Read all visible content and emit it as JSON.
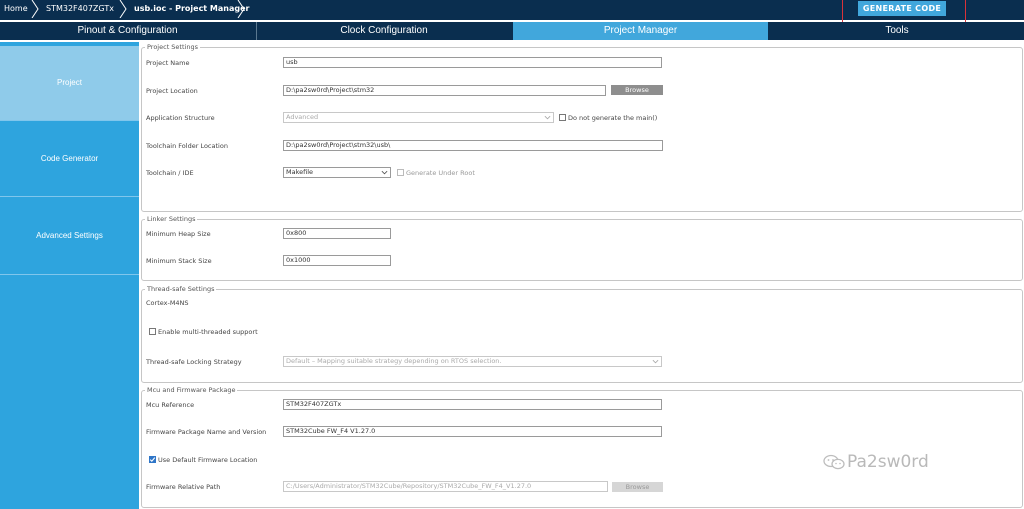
{
  "breadcrumb": {
    "home": "Home",
    "device": "STM32F407ZGTx",
    "file": "usb.ioc - Project Manager"
  },
  "toolbar": {
    "generate_code": "GENERATE CODE",
    "highlight_color": "#d9333a"
  },
  "tabs": [
    {
      "label": "Pinout & Configuration",
      "active": false
    },
    {
      "label": "Clock Configuration",
      "active": false
    },
    {
      "label": "Project Manager",
      "active": true
    },
    {
      "label": "Tools",
      "active": false
    }
  ],
  "sidebar": {
    "items": [
      {
        "label": "Project",
        "active": true
      },
      {
        "label": "Code Generator",
        "active": false
      },
      {
        "label": "Advanced Settings",
        "active": false
      }
    ]
  },
  "project_settings": {
    "legend": "Project Settings",
    "project_name_label": "Project Name",
    "project_name_value": "usb",
    "project_location_label": "Project Location",
    "project_location_value": "D:\\pa2sw0rd\\Project\\stm32",
    "browse_label": "Browse",
    "app_structure_label": "Application Structure",
    "app_structure_value": "Advanced",
    "no_main_label": "Do not generate the main()",
    "toolchain_folder_label": "Toolchain Folder Location",
    "toolchain_folder_value": "D:\\pa2sw0rd\\Project\\stm32\\usb\\",
    "toolchain_ide_label": "Toolchain / IDE",
    "toolchain_ide_value": "Makefile",
    "generate_under_root_label": "Generate Under Root"
  },
  "linker_settings": {
    "legend": "Linker Settings",
    "heap_label": "Minimum Heap Size",
    "heap_value": "0x800",
    "stack_label": "Minimum Stack Size",
    "stack_value": "0x1000"
  },
  "thread_safe": {
    "legend": "Thread-safe Settings",
    "core": "Cortex-M4NS",
    "multithread_label": "Enable multi-threaded support",
    "strategy_label": "Thread-safe Locking Strategy",
    "strategy_value": "Default  –  Mapping suitable strategy depending on RTOS selection."
  },
  "mcu_firmware": {
    "legend": "Mcu and Firmware Package",
    "mcu_ref_label": "Mcu Reference",
    "mcu_ref_value": "STM32F407ZGTx",
    "fw_pkg_label": "Firmware Package Name and Version",
    "fw_pkg_value": "STM32Cube FW_F4 V1.27.0",
    "use_default_label": "Use Default Firmware Location",
    "fw_path_label": "Firmware Relative Path",
    "fw_path_value": "C:/Users/Administrator/STM32Cube/Repository/STM32Cube_FW_F4_V1.27.0",
    "browse_label": "Browse"
  },
  "watermark": {
    "text": "Pa2sw0rd",
    "icon": "wechat-icon"
  }
}
